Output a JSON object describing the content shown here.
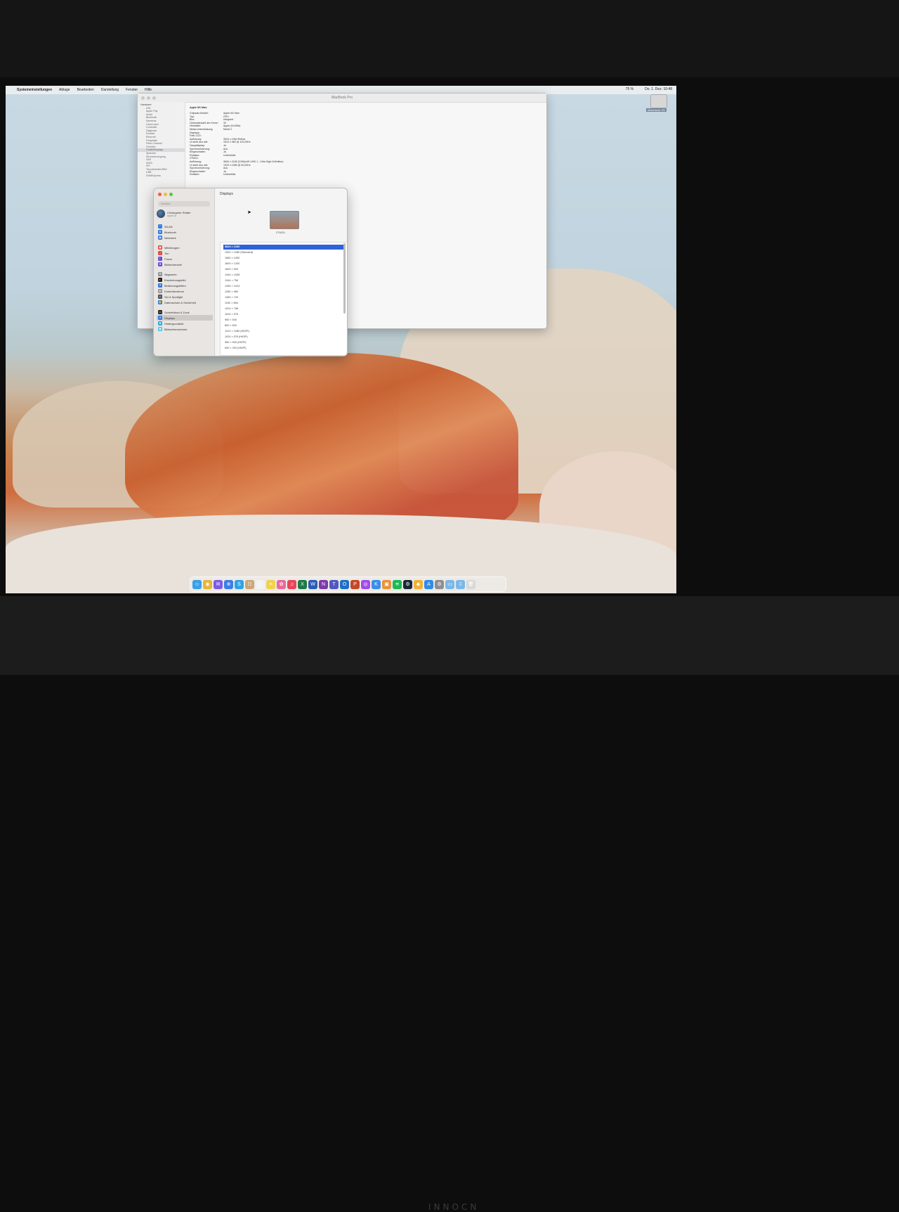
{
  "menubar": {
    "apple": "",
    "app_name": "Systemeinstellungen",
    "items": [
      "Ablage",
      "Bearbeiten",
      "Darstellung",
      "Fenster",
      "Hilfe"
    ],
    "status": [
      "75 %",
      "Do. 1. Dez. 10:48"
    ]
  },
  "desktop": {
    "disk_label": "Macintosh HD"
  },
  "system_info": {
    "title": "MacBook Pro",
    "sidebar": [
      {
        "label": "Hardware",
        "head": true
      },
      {
        "label": "ATA"
      },
      {
        "label": "Apple Pay"
      },
      {
        "label": "Audio"
      },
      {
        "label": "Bluetooth"
      },
      {
        "label": "Kameras"
      },
      {
        "label": "Card-Leser"
      },
      {
        "label": "Controller"
      },
      {
        "label": "Diagnose"
      },
      {
        "label": "Drucker"
      },
      {
        "label": "Ethernet"
      },
      {
        "label": "Festplatte"
      },
      {
        "label": "Fibre-Channel"
      },
      {
        "label": "FireWire"
      },
      {
        "label": "Grafik/Displays",
        "sel": true
      },
      {
        "label": "Speicher"
      },
      {
        "label": "Stromversorgung"
      },
      {
        "label": "SAS"
      },
      {
        "label": "SATA"
      },
      {
        "label": "SPI"
      },
      {
        "label": "Thunderbolt/USB4"
      },
      {
        "label": "USB"
      },
      {
        "label": "NVMExpress"
      }
    ],
    "heading": "Apple M1 Max:",
    "rows": [
      {
        "k": "Chipsatz-Modell:",
        "v": "Apple M1 Max"
      },
      {
        "k": "Typ:",
        "v": "GPU"
      },
      {
        "k": "Bus:",
        "v": "Integriert"
      },
      {
        "k": "Gesamtanzahl der Kerne:",
        "v": "32"
      },
      {
        "k": "Hersteller:",
        "v": "Apple (0x106b)"
      },
      {
        "k": "Metal-Unterstützung:",
        "v": "Metal 3"
      },
      {
        "k": "Displays:",
        "v": ""
      },
      {
        "k": "Farb-LCD:",
        "v": ""
      },
      {
        "k": "Auflösung:",
        "v": "3024 x 1964 Retina"
      },
      {
        "k": "UI sieht aus wie:",
        "v": "1512 x 982 @ 120,00Hz"
      },
      {
        "k": "Hauptdisplay:",
        "v": "Ja"
      },
      {
        "k": "Synchronisierung:",
        "v": "Aus"
      },
      {
        "k": "Eingeschaltet:",
        "v": "Ja"
      },
      {
        "k": "Rotation:",
        "v": "Unterstützt"
      },
      {
        "k": "27M2U:",
        "v": ""
      },
      {
        "k": "Auflösung:",
        "v": "3840 x 2160 (2160p/4K UHD 1 - Ultra High Definition)"
      },
      {
        "k": "UI sieht aus wie:",
        "v": "1920 x 1080 @ 60,00Hz"
      },
      {
        "k": "Synchronisierung:",
        "v": "Aus"
      },
      {
        "k": "Eingeschaltet:",
        "v": "Ja"
      },
      {
        "k": "Rotation:",
        "v": "Unterstützt"
      }
    ]
  },
  "displays": {
    "title": "Displays",
    "search_placeholder": "Suchen",
    "user": {
      "name": "Christopher Shafer",
      "sub": "Apple-ID"
    },
    "nav": [
      {
        "label": "WLAN",
        "color": "#2f7de1",
        "glyph": "◠"
      },
      {
        "label": "Bluetooth",
        "color": "#2f7de1",
        "glyph": "B"
      },
      {
        "label": "Netzwerk",
        "color": "#2f7de1",
        "glyph": "◉"
      },
      {
        "gap": true
      },
      {
        "label": "Mitteilungen",
        "color": "#e14b3d",
        "glyph": "▣"
      },
      {
        "label": "Ton",
        "color": "#e14b3d",
        "glyph": "♪"
      },
      {
        "label": "Fokus",
        "color": "#6a4bd6",
        "glyph": "☾"
      },
      {
        "label": "Bildschirmzeit",
        "color": "#6a4bd6",
        "glyph": "⧗"
      },
      {
        "gap": true
      },
      {
        "label": "Allgemein",
        "color": "#8e8e93",
        "glyph": "⚙"
      },
      {
        "label": "Erscheinungsbild",
        "color": "#222222",
        "glyph": "◐"
      },
      {
        "label": "Bedienungshilfen",
        "color": "#2f7de1",
        "glyph": "♿"
      },
      {
        "label": "Kontrollzentrum",
        "color": "#8e8e93",
        "glyph": "▤"
      },
      {
        "label": "Siri & Spotlight",
        "color": "#444444",
        "glyph": "◎"
      },
      {
        "label": "Datenschutz & Sicherheit",
        "color": "#2f7de1",
        "glyph": "✋"
      },
      {
        "gap": true
      },
      {
        "label": "Schreibtisch & Dock",
        "color": "#222222",
        "glyph": "▭"
      },
      {
        "label": "Displays",
        "color": "#2f7de1",
        "glyph": "☀",
        "sel": true
      },
      {
        "label": "Hintergrundbild",
        "color": "#2fa6e1",
        "glyph": "❀"
      },
      {
        "label": "Bildschirmschoner",
        "color": "#4bc2e1",
        "glyph": "▦"
      }
    ],
    "monitor_label": "27M2U",
    "resolutions": [
      "3824 × 2160",
      "1920 × 1080 (Standard)",
      "1680 × 1050",
      "1600 × 1200",
      "1600 × 900",
      "1344 × 1008",
      "1344 × 756",
      "1280 × 1024",
      "1280 × 960",
      "1280 × 720",
      "1152 × 864",
      "1024 × 768",
      "1024 × 576",
      "960 × 540",
      "800 × 600",
      "1412 × 1080 (HiDPI)",
      "1024 × 576 (HiDPI)",
      "960 × 540 (HiDPI)",
      "640 × 320 (HiDPI)"
    ],
    "selected_resolution": 0
  },
  "dock": [
    {
      "name": "finder-icon",
      "color": "#3aa0e8",
      "glyph": "☺"
    },
    {
      "name": "chrome-icon",
      "color": "#e8b53a",
      "glyph": "◉"
    },
    {
      "name": "messenger-icon",
      "color": "#7b5ce8",
      "glyph": "✉"
    },
    {
      "name": "safari-icon",
      "color": "#3a7ee8",
      "glyph": "⊕"
    },
    {
      "name": "skype-icon",
      "color": "#2fa3e6",
      "glyph": "S"
    },
    {
      "name": "contacts-icon",
      "color": "#c9a77a",
      "glyph": "☷"
    },
    {
      "name": "calendar-icon",
      "color": "#f2f2f2",
      "glyph": "1"
    },
    {
      "name": "notes-icon",
      "color": "#f2d24b",
      "glyph": "≡"
    },
    {
      "name": "photos-icon",
      "color": "#e86a9b",
      "glyph": "✿"
    },
    {
      "name": "music-icon",
      "color": "#e8455a",
      "glyph": "♫"
    },
    {
      "name": "excel-icon",
      "color": "#1f7a45",
      "glyph": "X"
    },
    {
      "name": "word-icon",
      "color": "#2b5bb8",
      "glyph": "W"
    },
    {
      "name": "onenote-icon",
      "color": "#7d3aa8",
      "glyph": "N"
    },
    {
      "name": "teams-icon",
      "color": "#5157c4",
      "glyph": "T"
    },
    {
      "name": "outlook-icon",
      "color": "#1f6fc4",
      "glyph": "O"
    },
    {
      "name": "powerpoint-icon",
      "color": "#c4482b",
      "glyph": "P"
    },
    {
      "name": "podcast-icon",
      "color": "#a24be8",
      "glyph": "◎"
    },
    {
      "name": "keynote-icon",
      "color": "#3a8ee8",
      "glyph": "K"
    },
    {
      "name": "box-icon",
      "color": "#e8923a",
      "glyph": "▣"
    },
    {
      "name": "spotify-icon",
      "color": "#1db954",
      "glyph": "≋"
    },
    {
      "name": "steam-icon",
      "color": "#1b2838",
      "glyph": "⚙"
    },
    {
      "name": "sketch-icon",
      "color": "#f2b233",
      "glyph": "◆"
    },
    {
      "name": "appstore-icon",
      "color": "#2f8de8",
      "glyph": "A"
    },
    {
      "name": "settings-icon",
      "color": "#8e8e93",
      "glyph": "⚙"
    },
    {
      "name": "finder-folder-icon",
      "color": "#7ab8e8",
      "glyph": "▭"
    },
    {
      "name": "downloads-icon",
      "color": "#7ab8e8",
      "glyph": "⇩"
    },
    {
      "name": "trash-icon",
      "color": "#d8d8d8",
      "glyph": "🗑"
    }
  ]
}
